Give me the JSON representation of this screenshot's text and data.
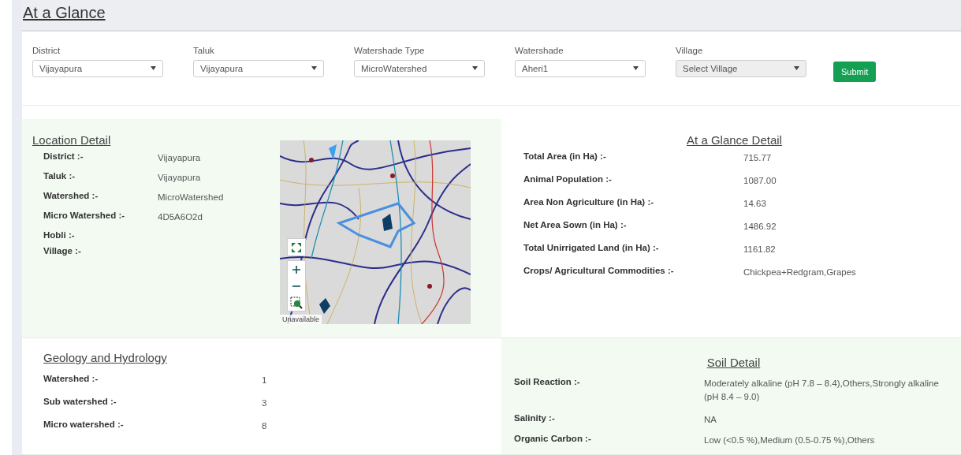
{
  "page_title": "At a Glance",
  "filters": [
    {
      "label": "District",
      "value": "Vijayapura",
      "disabled": false
    },
    {
      "label": "Taluk",
      "value": "Vijayapura",
      "disabled": false
    },
    {
      "label": "Watershade Type",
      "value": "MicroWatershed",
      "disabled": false
    },
    {
      "label": "Watershade",
      "value": "Aheri1",
      "disabled": false
    },
    {
      "label": "Village",
      "value": "Select Village",
      "disabled": true
    }
  ],
  "submit_button": "Submit",
  "location_detail": {
    "title": "Location Detail",
    "rows": [
      {
        "label": "District :-",
        "value": "Vijayapura"
      },
      {
        "label": "Taluk :-",
        "value": "Vijayapura"
      },
      {
        "label": "Watershed :-",
        "value": "MicroWatershed"
      },
      {
        "label": "Micro Watershed :-",
        "value": "4D5A6O2d"
      },
      {
        "label": "Hobli :-"
      },
      {
        "label": "Village :-"
      }
    ],
    "map": {
      "attribution": "Unavailable"
    }
  },
  "glance_detail": {
    "title": "At a Glance Detail",
    "rows": [
      {
        "label": "Total Area (in Ha) :-",
        "value": "715.77"
      },
      {
        "label": "Animal Population :-",
        "value": "1087.00"
      },
      {
        "label": "Area Non Agriculture (in Ha) :-",
        "value": "14.63"
      },
      {
        "label": "Net Area Sown (in Ha) :-",
        "value": "1486.92"
      },
      {
        "label": "Total Unirrigated Land (in Ha) :-",
        "value": "1161.82"
      },
      {
        "label": "Crops/ Agricultural Commodities :-",
        "value": "Chickpea+Redgram,Grapes"
      }
    ]
  },
  "geology_hydrology": {
    "title": "Geology and Hydrology",
    "rows": [
      {
        "label": "Watershed :-",
        "value": "1"
      },
      {
        "label": "Sub watershed :-",
        "value": "3"
      },
      {
        "label": "Micro watershed :-",
        "value": "8"
      }
    ]
  },
  "soil_detail": {
    "title": "Soil Detail",
    "rows": [
      {
        "label": "Soil Reaction :-",
        "value": "Moderately alkaline (pH 7.8 – 8.4),Others,Strongly alkaline (pH 8.4 – 9.0)"
      },
      {
        "label": "Salinity :-",
        "value": "NA"
      },
      {
        "label": "Organic Carbon :-",
        "value": "Low (<0.5 %),Medium (0.5-0.75 %),Others"
      }
    ]
  }
}
